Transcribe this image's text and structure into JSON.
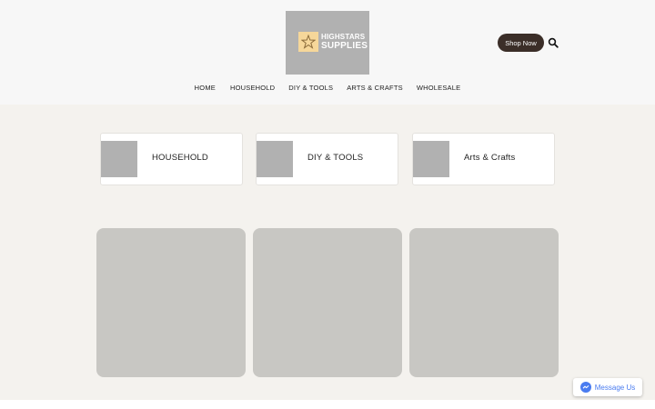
{
  "header": {
    "logo": {
      "line1": "HIGHSTARS",
      "line2": "SUPPLIES",
      "icon": "star-logo-icon"
    },
    "shop_button": "Shop Now",
    "search_icon": "search-icon"
  },
  "nav": {
    "items": [
      "HOME",
      "HOUSEHOLD",
      "DIY & TOOLS",
      "ARTS & CRAFTS",
      "WHOLESALE"
    ]
  },
  "categories": [
    {
      "label": "HOUSEHOLD"
    },
    {
      "label": "DIY & TOOLS"
    },
    {
      "label": "Arts & Crafts"
    }
  ],
  "messenger": {
    "label": "Message Us",
    "icon": "messenger-icon"
  },
  "colors": {
    "header_bg": "#f7f7f7",
    "main_bg": "#f4f2ee",
    "button_dark": "#3b2e28",
    "tile": "#c8c7c3",
    "placeholder": "#b1b1b1",
    "messenger_blue": "#4a7cf0"
  }
}
